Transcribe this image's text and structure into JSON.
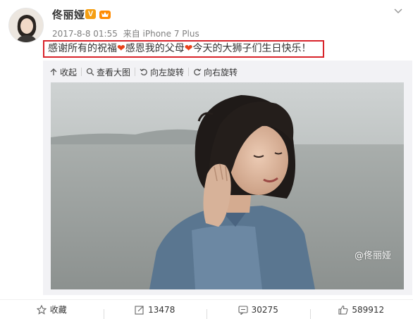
{
  "user": {
    "name": "佟丽娅",
    "verified_badge": "V",
    "time": "2017-8-8 01:55",
    "source": "来自 iPhone 7 Plus"
  },
  "post": {
    "segments": [
      "感谢所有的祝福",
      "感恩我的父母",
      "今天的大狮子们生日快乐！"
    ],
    "heart": "❤"
  },
  "toolbar": {
    "collapse": "收起",
    "view_large": "查看大图",
    "rotate_left": "向左旋转",
    "rotate_right": "向右旋转"
  },
  "watermark": "@佟丽娅",
  "footer": {
    "favorite": "收藏",
    "repost_count": "13478",
    "comment_count": "30275",
    "like_count": "589912"
  },
  "colors": {
    "highlight_border": "#d8232a",
    "heart": "#e8421a",
    "verified": "#f59f13"
  }
}
